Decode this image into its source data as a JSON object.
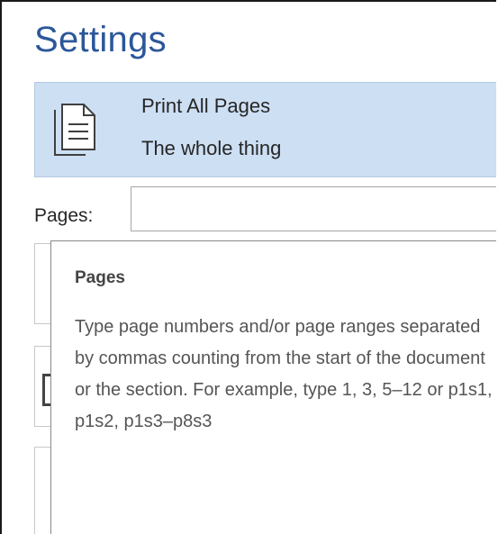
{
  "section_title": "Settings",
  "print_option": {
    "title": "Print All Pages",
    "subtitle": "The whole thing",
    "icon": "document-pages-icon"
  },
  "pages_field": {
    "label": "Pages:",
    "value": "",
    "placeholder": ""
  },
  "tooltip": {
    "title": "Pages",
    "body": "Type page numbers and/or page ranges separated by commas counting from the start of the document or the section. For example, type 1, 3, 5–12 or p1s1, p1s2, p1s3–p8s3"
  },
  "colors": {
    "accent": "#2b579a",
    "selected_background": "#cddff3",
    "text": "#262626",
    "tooltip_text": "#555555"
  }
}
